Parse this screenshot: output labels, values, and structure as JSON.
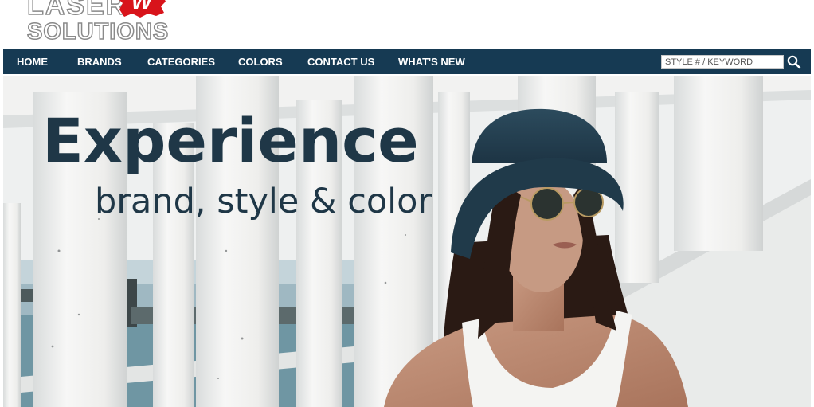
{
  "logo": {
    "line1": "LASER",
    "badge": "W",
    "line2": "SOLUTIONS"
  },
  "nav": {
    "items": [
      {
        "label": "HOME"
      },
      {
        "label": "BRANDS"
      },
      {
        "label": "CATEGORIES"
      },
      {
        "label": "COLORS"
      },
      {
        "label": "CONTACT US"
      },
      {
        "label": "WHAT'S NEW"
      }
    ],
    "search": {
      "placeholder": "STYLE # / KEYWORD",
      "icon": "search-icon"
    }
  },
  "hero": {
    "headline": "Experience",
    "subheadline": "brand, style & color"
  },
  "colors": {
    "nav_background": "#163a53",
    "headline_text": "#1f3747",
    "logo_badge": "#d8141b"
  }
}
